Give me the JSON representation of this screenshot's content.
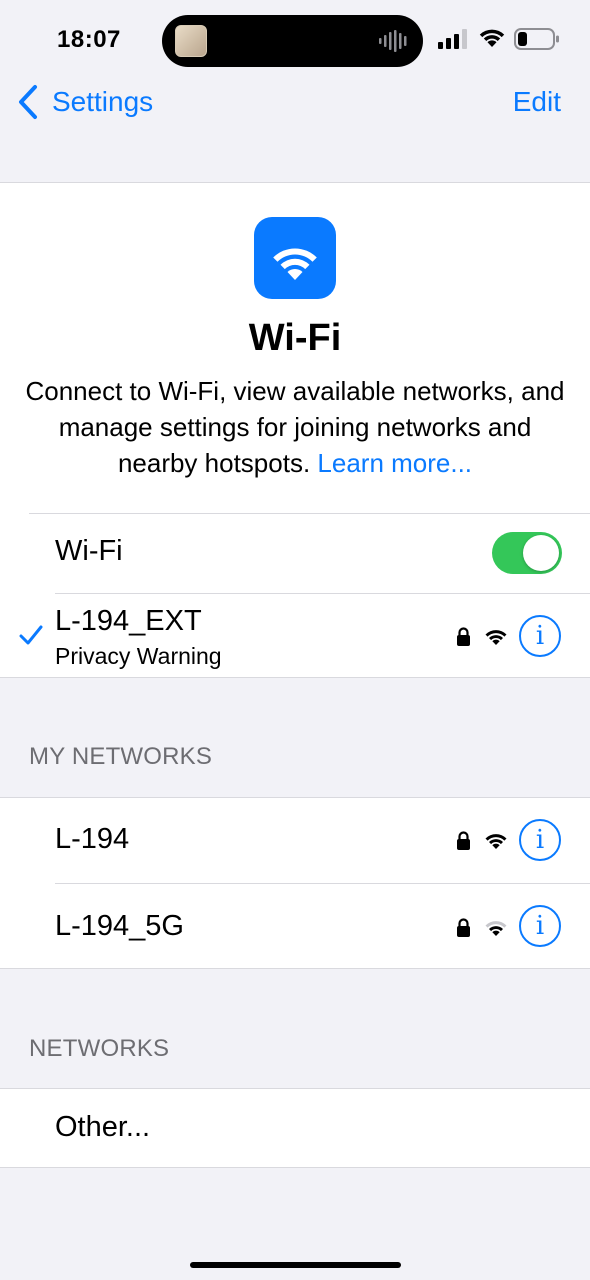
{
  "status_bar": {
    "time": "18:07",
    "icons": [
      "cellular-signal-icon",
      "wifi-icon",
      "battery-icon"
    ]
  },
  "nav": {
    "back_label": "Settings",
    "edit_label": "Edit"
  },
  "header": {
    "title": "Wi-Fi",
    "description": "Connect to Wi-Fi, view available networks, and manage settings for joining networks and nearby hotspots.",
    "learn_more": "Learn more..."
  },
  "wifi_toggle": {
    "label": "Wi-Fi",
    "on": true
  },
  "current_network": {
    "name": "L-194_EXT",
    "subtitle": "Privacy Warning"
  },
  "my_networks": {
    "header": "MY NETWORKS",
    "items": [
      {
        "name": "L-194"
      },
      {
        "name": "L-194_5G"
      }
    ]
  },
  "networks": {
    "header": "NETWORKS",
    "other_label": "Other..."
  },
  "colors": {
    "accent": "#0a7aff",
    "toggle_on": "#34c759",
    "background": "#f2f2f7"
  }
}
